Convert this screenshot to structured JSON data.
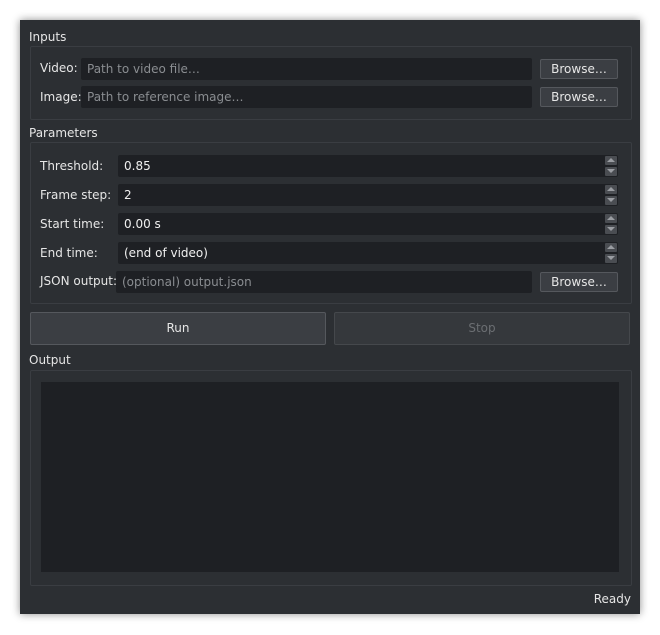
{
  "inputs": {
    "title": "Inputs",
    "video_label": "Video:",
    "video_placeholder": "Path to video file…",
    "image_label": "Image:",
    "image_placeholder": "Path to reference image…",
    "browse_label": "Browse…"
  },
  "parameters": {
    "title": "Parameters",
    "threshold_label": "Threshold:",
    "threshold_value": "0.85",
    "frame_step_label": "Frame step:",
    "frame_step_value": "2",
    "start_time_label": "Start time:",
    "start_time_value": "0.00 s",
    "end_time_label": "End time:",
    "end_time_value": "(end of video)",
    "json_output_label": "JSON output:",
    "json_output_placeholder": "(optional) output.json",
    "browse_label": "Browse…"
  },
  "actions": {
    "run_label": "Run",
    "stop_label": "Stop"
  },
  "output": {
    "title": "Output",
    "content": ""
  },
  "status": {
    "text": "Ready"
  },
  "icons": {
    "spin_up": "chevron-up-icon",
    "spin_down": "chevron-down-icon"
  },
  "colors": {
    "window_bg": "#2c2f33",
    "field_bg": "#1e2024",
    "button_bg": "#3b3e43",
    "text": "#e6e6e6",
    "placeholder": "#8a8d91"
  }
}
